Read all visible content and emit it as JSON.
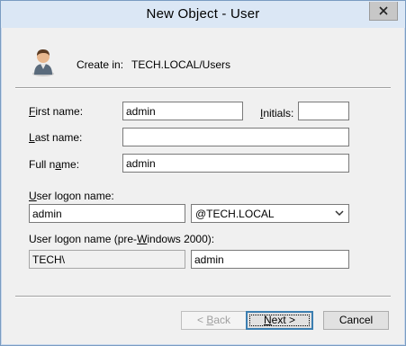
{
  "window": {
    "title": "New Object - User"
  },
  "header": {
    "create_in_label": "Create in:",
    "create_in_value": "TECH.LOCAL/Users",
    "icon": "user-icon"
  },
  "form": {
    "first_name": {
      "label_pre": "",
      "label_u": "F",
      "label_post": "irst name:",
      "value": "admin"
    },
    "initials": {
      "label_pre": "",
      "label_u": "I",
      "label_post": "nitials:",
      "value": ""
    },
    "last_name": {
      "label_pre": "",
      "label_u": "L",
      "label_post": "ast name:",
      "value": ""
    },
    "full_name": {
      "label_pre": "Full n",
      "label_u": "a",
      "label_post": "me:",
      "value": "admin"
    },
    "logon_name": {
      "label_pre": "",
      "label_u": "U",
      "label_post": "ser logon name:",
      "value": "admin",
      "domain": "@TECH.LOCAL"
    },
    "logon_name_pre2000": {
      "label_pre": "User logon name (pre-",
      "label_u": "W",
      "label_post": "indows 2000):",
      "domain": "TECH\\",
      "value": "admin"
    }
  },
  "buttons": {
    "back": {
      "pre": "< ",
      "u": "B",
      "post": "ack"
    },
    "next": {
      "pre": "",
      "u": "N",
      "post": "ext >"
    },
    "cancel": "Cancel"
  },
  "colors": {
    "titlebar": "#dbe7f5",
    "border": "#7a9cc2",
    "default_button": "#3c7fb1"
  }
}
